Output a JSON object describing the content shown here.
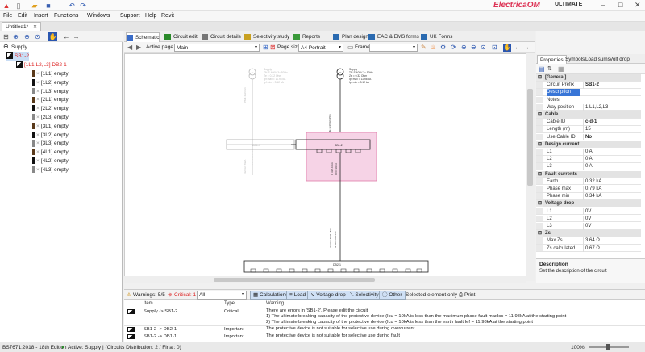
{
  "app": {
    "brand": "ElectricaOM",
    "edition": "ULTIMATE"
  },
  "menu": [
    "File",
    "Edit",
    "Insert",
    "Functions",
    "Windows",
    "Support",
    "Help",
    "Revit"
  ],
  "document_tab": "Untitled1*",
  "tree": {
    "root": "Supply",
    "board": "SB1-2",
    "child": "[1L1,L2,L3] DB2-1",
    "ways": [
      {
        "label": "[1L1] empty",
        "color": "#5a3a1a"
      },
      {
        "label": "[1L2] empty",
        "color": "#111111"
      },
      {
        "label": "[1L3] empty",
        "color": "#888888"
      },
      {
        "label": "[2L1] empty",
        "color": "#5a3a1a"
      },
      {
        "label": "[2L2] empty",
        "color": "#111111"
      },
      {
        "label": "[2L3] empty",
        "color": "#888888"
      },
      {
        "label": "[3L1] empty",
        "color": "#5a3a1a"
      },
      {
        "label": "[3L2] empty",
        "color": "#111111"
      },
      {
        "label": "[3L3] empty",
        "color": "#888888"
      },
      {
        "label": "[4L1] empty",
        "color": "#5a3a1a"
      },
      {
        "label": "[4L2] empty",
        "color": "#111111"
      },
      {
        "label": "[4L3] empty",
        "color": "#888888"
      }
    ]
  },
  "center_tabs": [
    {
      "label": "Schematic",
      "color": "#3a6cc8"
    },
    {
      "label": "Circuit edit",
      "color": "#2a8a2a"
    },
    {
      "label": "Circuit details",
      "color": "#777777"
    },
    {
      "label": "Selectivity study",
      "color": "#c8a020"
    },
    {
      "label": "Reports",
      "color": "#3a9a3a"
    },
    {
      "label": "Plan design",
      "color": "#2a6ab0"
    },
    {
      "label": "EAC & EMS forms",
      "color": "#2a6ab0"
    },
    {
      "label": "UK Forms",
      "color": "#2a6ab0"
    }
  ],
  "toolbar": {
    "active_page_label": "Active page",
    "active_page_value": "Main",
    "page_size_label": "Page size",
    "page_size_value": "A4 Portrait",
    "frame_label": "Frame"
  },
  "schematic": {
    "supply_text_lines": [
      "Supply",
      "TN-S 400V 3~ 50Hz",
      "Ze = 0.32 Ohm",
      "Ipf max = 11.98 kA",
      "Ipf min = 3.12 kA"
    ],
    "board_label": "SB1-2",
    "left_board_label": "DB1-1",
    "bottom_board_label": "DB2-1"
  },
  "right_tabs": [
    "Properties",
    "Symbols",
    "Load sums",
    "Volt drop"
  ],
  "properties": [
    {
      "type": "group",
      "label": "[General]"
    },
    {
      "label": "Circuit Prefix",
      "value": "SB1-2",
      "bold": true
    },
    {
      "label": "Description",
      "value": "",
      "selected": true
    },
    {
      "label": "Notes",
      "value": ""
    },
    {
      "label": "Way position",
      "value": "1,L1,L2,L3"
    },
    {
      "type": "group",
      "label": "Cable"
    },
    {
      "label": "Cable ID",
      "value": "c-d-1",
      "bold": true
    },
    {
      "label": "Length (m)",
      "value": "15"
    },
    {
      "label": "Use Cable ID",
      "value": "No",
      "bold": true
    },
    {
      "type": "group",
      "label": "Design current"
    },
    {
      "label": "L1",
      "value": "0 A"
    },
    {
      "label": "L2",
      "value": "0 A"
    },
    {
      "label": "L3",
      "value": "0 A"
    },
    {
      "type": "group",
      "label": "Fault currents"
    },
    {
      "label": "Earth",
      "value": "0.32 kA"
    },
    {
      "label": "Phase max",
      "value": "0.79 kA"
    },
    {
      "label": "Phase min",
      "value": "0.34 kA"
    },
    {
      "type": "group",
      "label": "Voltage drop"
    },
    {
      "label": "L1",
      "value": "0V"
    },
    {
      "label": "L2",
      "value": "0V"
    },
    {
      "label": "L3",
      "value": "0V"
    },
    {
      "type": "group",
      "label": "Zs"
    },
    {
      "label": "Max Zs",
      "value": "3.64 Ω"
    },
    {
      "label": "Zs calculated",
      "value": "0.67 Ω"
    }
  ],
  "prop_description": {
    "title": "Description",
    "text": "Set the description of the circuit"
  },
  "warnings_bar": {
    "warnings": "Warnings: 5/5",
    "critical": "Critical: 1",
    "filter": "All",
    "calculations": "Calculations",
    "load": "Load",
    "voltage_drop": "Voltage drop",
    "selectivity": "Selectivity",
    "other": "Other",
    "selected_only": "Selected element only",
    "print": "Print"
  },
  "warn_headers": {
    "item": "Item",
    "type": "Type",
    "warning": "Warning"
  },
  "warnings": [
    {
      "item": "Supply -> SB1-2",
      "type": "Critical",
      "lines": [
        "There are errors in 'SB1-2'. Please edit the circuit",
        "1) The ultimate breaking capacity of the protective device (Icu = 10kA is less than the maximum phase fault maxIsc = 11.98kA at the starting point",
        "2) The ultimate breaking capacity of the protective device (Icu = 10kA is less than the earth fault Ief = 11.98kA at the starting point"
      ]
    },
    {
      "item": "SB1-2 -> DB2-1",
      "type": "Important",
      "lines": [
        "The protective device is not suitable for selective use during overcurrent"
      ]
    },
    {
      "item": "SB1-2 -> DB1-1",
      "type": "Important",
      "lines": [
        "The protective device is not suitable for selective use during fault"
      ]
    }
  ],
  "status": {
    "standard": "BS7671:2018 - 18th Edition",
    "active": "Active: Supply | (Circuits Distribution: 2 / Final: 0)",
    "zoom": "100%"
  }
}
